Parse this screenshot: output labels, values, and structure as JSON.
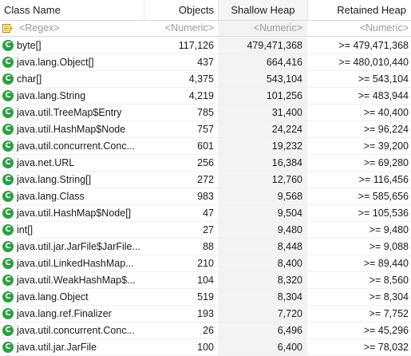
{
  "columns": {
    "name": "Class Name",
    "objects": "Objects",
    "shallow": "Shallow Heap",
    "retained": "Retained Heap"
  },
  "filter": {
    "name": "<Regex>",
    "objects": "<Numeric>",
    "shallow": "<Numeric>",
    "retained": "<Numeric>"
  },
  "class_icon_glyph": "C",
  "rows": [
    {
      "name": "byte[]",
      "objects": "117,126",
      "shallow": "479,471,368",
      "retained": ">= 479,471,368"
    },
    {
      "name": "java.lang.Object[]",
      "objects": "437",
      "shallow": "664,416",
      "retained": ">= 480,010,440"
    },
    {
      "name": "char[]",
      "objects": "4,375",
      "shallow": "543,104",
      "retained": ">= 543,104"
    },
    {
      "name": "java.lang.String",
      "objects": "4,219",
      "shallow": "101,256",
      "retained": ">= 483,944"
    },
    {
      "name": "java.util.TreeMap$Entry",
      "objects": "785",
      "shallow": "31,400",
      "retained": ">= 40,400"
    },
    {
      "name": "java.util.HashMap$Node",
      "objects": "757",
      "shallow": "24,224",
      "retained": ">= 96,224"
    },
    {
      "name": "java.util.concurrent.Conc...",
      "objects": "601",
      "shallow": "19,232",
      "retained": ">= 39,200"
    },
    {
      "name": "java.net.URL",
      "objects": "256",
      "shallow": "16,384",
      "retained": ">= 69,280"
    },
    {
      "name": "java.lang.String[]",
      "objects": "272",
      "shallow": "12,760",
      "retained": ">= 116,456"
    },
    {
      "name": "java.lang.Class",
      "objects": "983",
      "shallow": "9,568",
      "retained": ">= 585,656"
    },
    {
      "name": "java.util.HashMap$Node[]",
      "objects": "47",
      "shallow": "9,504",
      "retained": ">= 105,536"
    },
    {
      "name": "int[]",
      "objects": "27",
      "shallow": "9,480",
      "retained": ">= 9,480"
    },
    {
      "name": "java.util.jar.JarFile$JarFile...",
      "objects": "88",
      "shallow": "8,448",
      "retained": ">= 9,088"
    },
    {
      "name": "java.util.LinkedHashMap...",
      "objects": "210",
      "shallow": "8,400",
      "retained": ">= 89,440"
    },
    {
      "name": "java.util.WeakHashMap$...",
      "objects": "104",
      "shallow": "8,320",
      "retained": ">= 8,560"
    },
    {
      "name": "java.lang.Object",
      "objects": "519",
      "shallow": "8,304",
      "retained": ">= 8,304"
    },
    {
      "name": "java.lang.ref.Finalizer",
      "objects": "193",
      "shallow": "7,720",
      "retained": ">= 7,752"
    },
    {
      "name": "java.util.concurrent.Conc...",
      "objects": "26",
      "shallow": "6,496",
      "retained": ">= 45,296"
    },
    {
      "name": "java.util.jar.JarFile",
      "objects": "100",
      "shallow": "6,400",
      "retained": ">= 78,032"
    }
  ],
  "colors": {
    "class_icon": "#2e9e43",
    "shallow_column_bg": "#f3f3f3",
    "filter_text": "#9a9a9a"
  }
}
